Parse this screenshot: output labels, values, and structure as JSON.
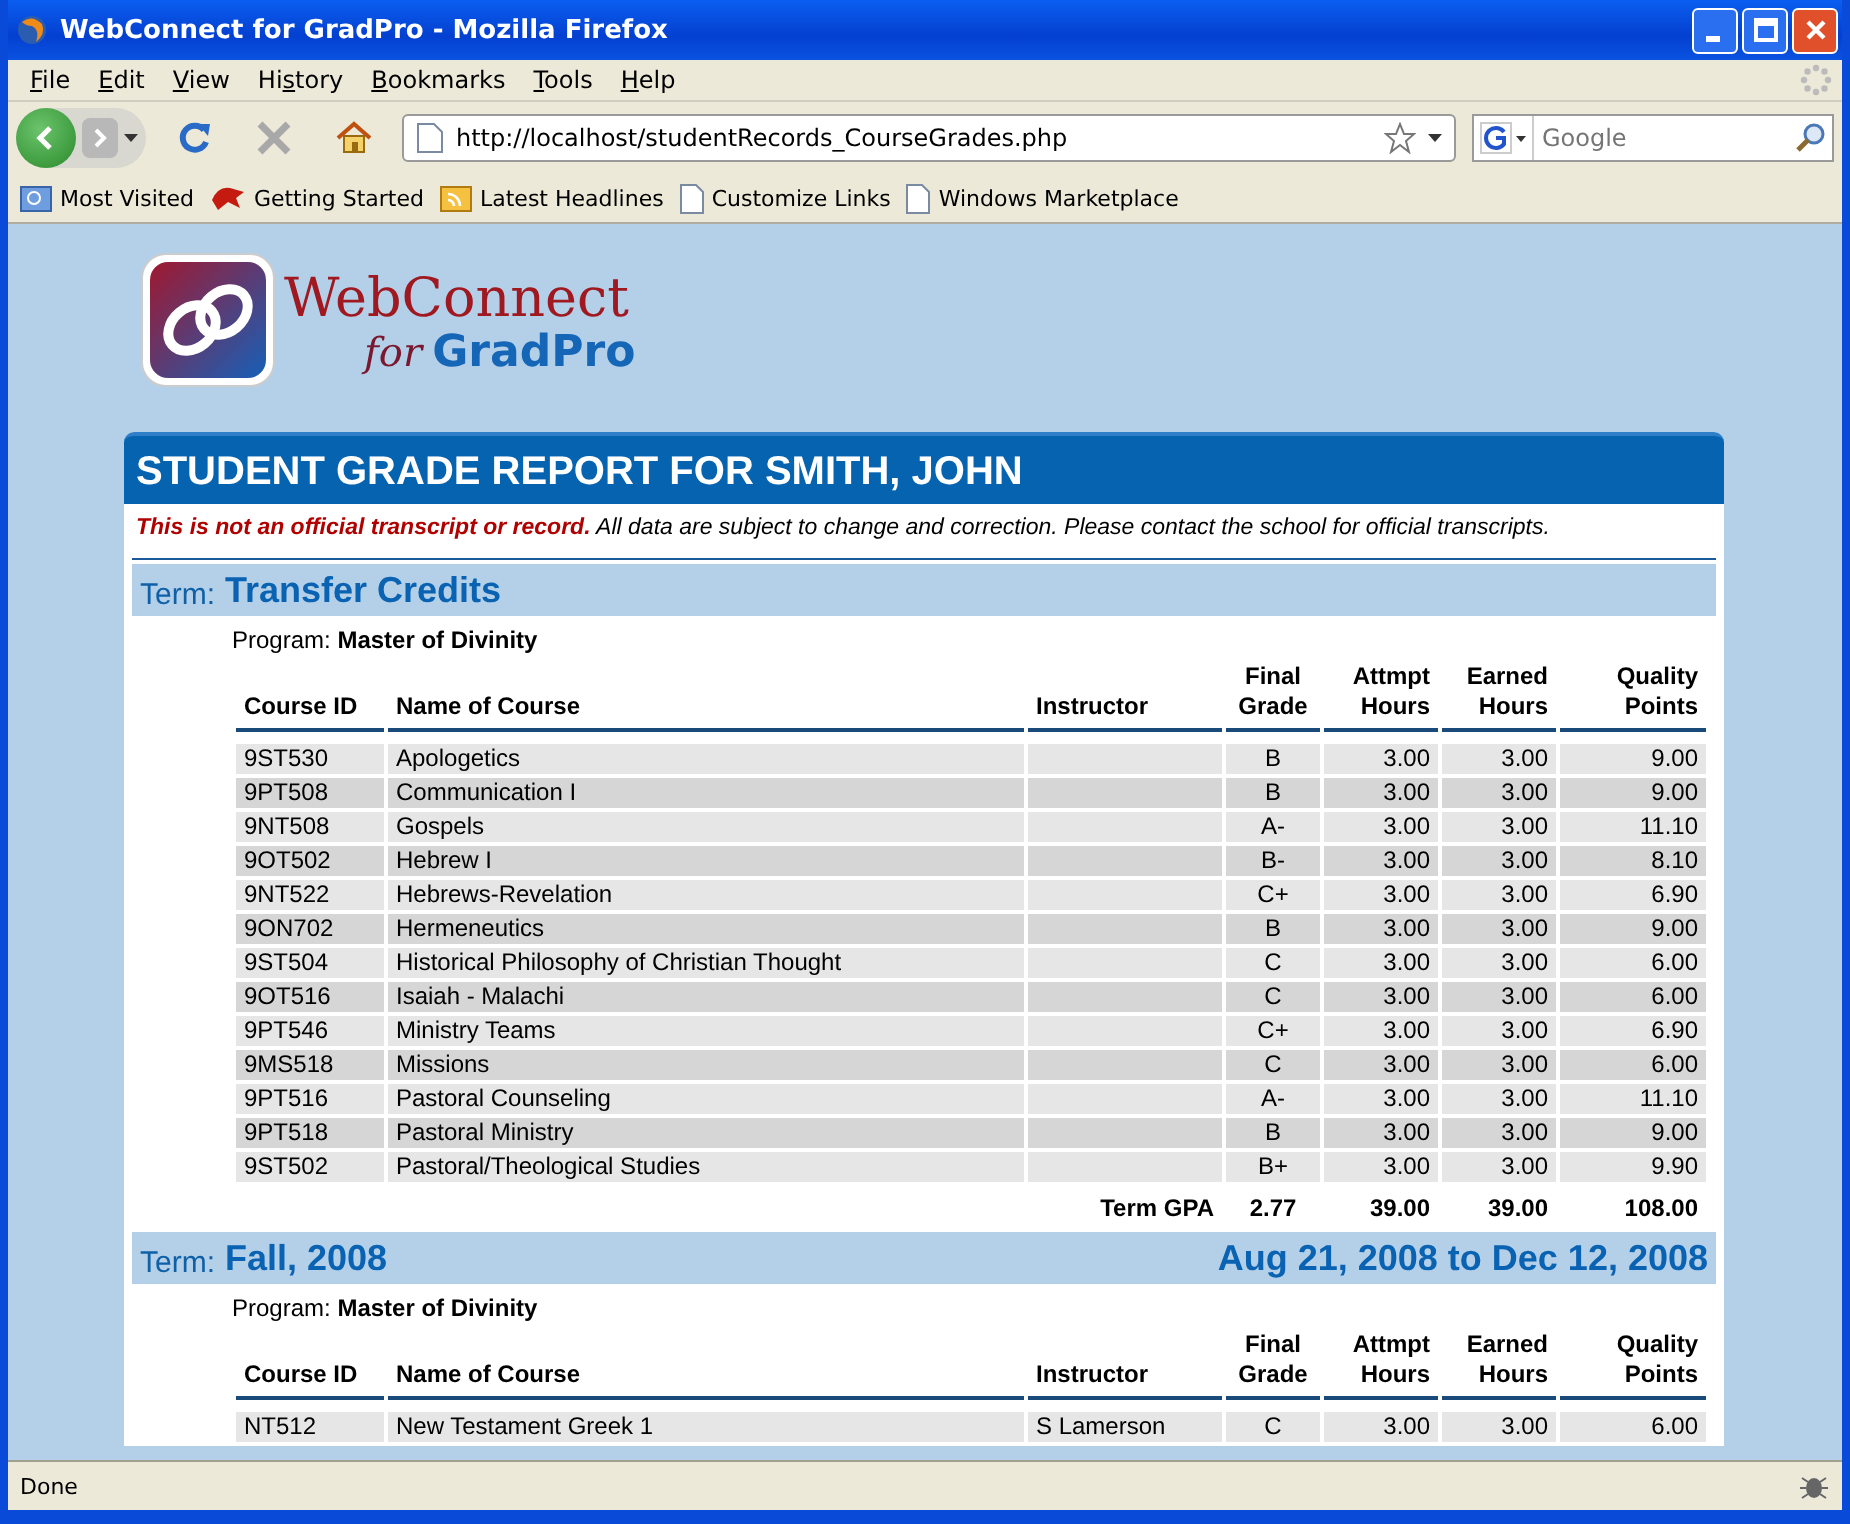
{
  "window": {
    "title": "WebConnect for GradPro - Mozilla Firefox"
  },
  "menu": [
    "File",
    "Edit",
    "View",
    "History",
    "Bookmarks",
    "Tools",
    "Help"
  ],
  "address_bar": {
    "url": "http://localhost/studentRecords_CourseGrades.php"
  },
  "search": {
    "placeholder": "Google"
  },
  "bookmarks": [
    "Most Visited",
    "Getting Started",
    "Latest Headlines",
    "Customize Links",
    "Windows Marketplace"
  ],
  "logo": {
    "title": "WebConnect",
    "prefix": "for",
    "product": "GradPro"
  },
  "report_title": "STUDENT GRADE REPORT FOR SMITH, JOHN",
  "notice": {
    "warning": "This is not an official transcript or record.",
    "text": "All data are subject to change and correction. Please contact the school for official transcripts."
  },
  "terms": [
    {
      "label": "Term:",
      "name": "Transfer Credits",
      "program_label": "Program:",
      "program": "Master of Divinity",
      "columns": [
        "Course ID",
        "Name of Course",
        "Instructor",
        "Final Grade",
        "Attmpt Hours",
        "Earned Hours",
        "Quality Points"
      ],
      "rows": [
        [
          "9ST530",
          "Apologetics",
          "",
          "B",
          "3.00",
          "3.00",
          "9.00"
        ],
        [
          "9PT508",
          "Communication I",
          "",
          "B",
          "3.00",
          "3.00",
          "9.00"
        ],
        [
          "9NT508",
          "Gospels",
          "",
          "A-",
          "3.00",
          "3.00",
          "11.10"
        ],
        [
          "9OT502",
          "Hebrew I",
          "",
          "B-",
          "3.00",
          "3.00",
          "8.10"
        ],
        [
          "9NT522",
          "Hebrews-Revelation",
          "",
          "C+",
          "3.00",
          "3.00",
          "6.90"
        ],
        [
          "9ON702",
          "Hermeneutics",
          "",
          "B",
          "3.00",
          "3.00",
          "9.00"
        ],
        [
          "9ST504",
          "Historical Philosophy of Christian Thought",
          "",
          "C",
          "3.00",
          "3.00",
          "6.00"
        ],
        [
          "9OT516",
          "Isaiah - Malachi",
          "",
          "C",
          "3.00",
          "3.00",
          "6.00"
        ],
        [
          "9PT546",
          "Ministry Teams",
          "",
          "C+",
          "3.00",
          "3.00",
          "6.90"
        ],
        [
          "9MS518",
          "Missions",
          "",
          "C",
          "3.00",
          "3.00",
          "6.00"
        ],
        [
          "9PT516",
          "Pastoral Counseling",
          "",
          "A-",
          "3.00",
          "3.00",
          "11.10"
        ],
        [
          "9PT518",
          "Pastoral Ministry",
          "",
          "B",
          "3.00",
          "3.00",
          "9.00"
        ],
        [
          "9ST502",
          "Pastoral/Theological Studies",
          "",
          "B+",
          "3.00",
          "3.00",
          "9.90"
        ]
      ],
      "totals": {
        "label": "Term GPA",
        "values": [
          "2.77",
          "39.00",
          "39.00",
          "108.00"
        ]
      }
    },
    {
      "label": "Term:",
      "name": "Fall, 2008",
      "dates": "Aug 21, 2008 to Dec 12, 2008",
      "program_label": "Program:",
      "program": "Master of Divinity",
      "columns": [
        "Course ID",
        "Name of Course",
        "Instructor",
        "Final Grade",
        "Attmpt Hours",
        "Earned Hours",
        "Quality Points"
      ],
      "rows": [
        [
          "NT512",
          "New Testament Greek 1",
          "S Lamerson",
          "C",
          "3.00",
          "3.00",
          "6.00"
        ]
      ]
    }
  ],
  "status_bar": {
    "text": "Done"
  }
}
